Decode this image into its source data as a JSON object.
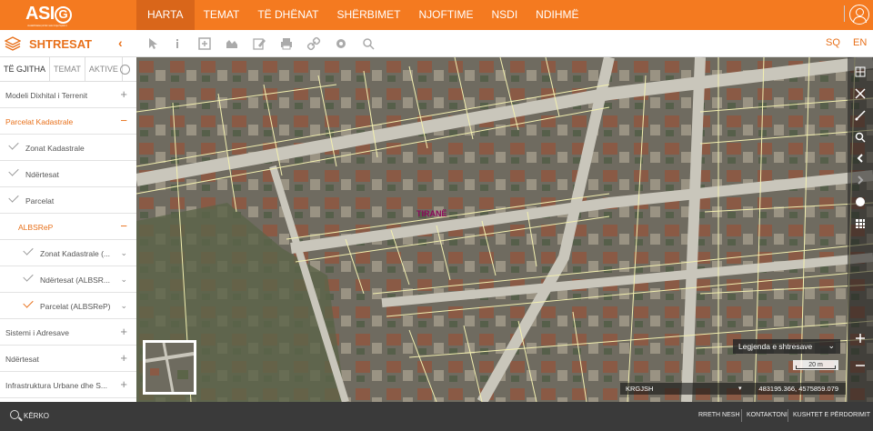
{
  "logo": {
    "text_a": "ASI",
    "text_b": "G",
    "tagline": "Autoriteti Shtetëror për Informacionin Gjeohapësinor"
  },
  "nav": [
    "HARTA",
    "TEMAT",
    "TË DHËNAT",
    "SHËRBIMET",
    "NJOFTIME",
    "NSDI",
    "NDIHMË"
  ],
  "panel": {
    "title": "SHTRESAT",
    "collapse": "‹"
  },
  "toolbar": {
    "lang_sq": "SQ",
    "lang_en": "EN"
  },
  "tabs": [
    "TË GJITHA",
    "TEMAT",
    "AKTIVE"
  ],
  "layers": [
    {
      "label": "Modeli Dixhital i Terrenit",
      "toggle": "+",
      "kind": "top"
    },
    {
      "label": "Parcelat Kadastrale",
      "toggle": "−",
      "kind": "top-open"
    },
    {
      "label": "Zonat Kadastrale",
      "kind": "check"
    },
    {
      "label": "Ndërtesat",
      "kind": "check"
    },
    {
      "label": "Parcelat",
      "kind": "check"
    },
    {
      "label": "ALBSReP",
      "toggle": "−",
      "kind": "group-open"
    },
    {
      "label": "Zonat Kadastrale (...",
      "kind": "sub-check",
      "toggle": "⌄"
    },
    {
      "label": "Ndërtesat (ALBSR...",
      "kind": "sub-check",
      "toggle": "⌄"
    },
    {
      "label": "Parcelat (ALBSReP)",
      "kind": "sub-check-on",
      "toggle": "⌄"
    },
    {
      "label": "Sistemi i Adresave",
      "toggle": "+",
      "kind": "top"
    },
    {
      "label": "Ndërtesat",
      "toggle": "+",
      "kind": "top"
    },
    {
      "label": "Infrastruktura Urbane dhe S...",
      "toggle": "+",
      "kind": "top"
    }
  ],
  "map": {
    "place_label": "TIRANË",
    "legend": "Legjenda e shtresave",
    "scale": "20 m",
    "crs": "KRGJSH",
    "coords": "483195.366, 4575859.079"
  },
  "footer": {
    "search": "KËRKO",
    "links": [
      "RRETH NESH",
      "KONTAKTONI",
      "KUSHTET E PËRDORIMIT"
    ]
  },
  "colors": {
    "accent": "#f47a20",
    "footer": "#3a3a3a",
    "parcel_line": "#f3f0b0",
    "roof": "#8a5a45"
  }
}
